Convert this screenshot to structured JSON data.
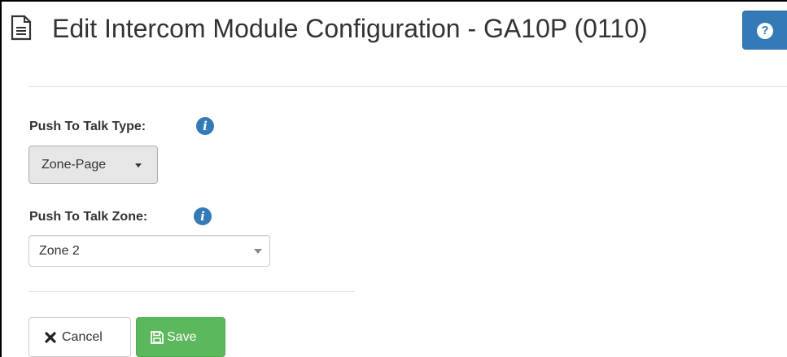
{
  "header": {
    "title": "Edit Intercom Module Configuration - GA10P (0110)",
    "doc_icon": "document-icon",
    "help_icon": "question-circle-icon",
    "help_icon_glyph": "?"
  },
  "form": {
    "push_to_talk_type": {
      "label": "Push To Talk Type:",
      "info_icon": "info-circle-icon",
      "info_glyph": "i",
      "selected": "Zone-Page"
    },
    "push_to_talk_zone": {
      "label": "Push To Talk Zone:",
      "info_icon": "info-circle-icon",
      "info_glyph": "i",
      "selected": "Zone 2"
    }
  },
  "actions": {
    "cancel_label": "Cancel",
    "cancel_icon": "close-icon",
    "save_label": "Save",
    "save_icon": "floppy-disk-icon"
  },
  "colors": {
    "primary": "#337ab7",
    "success": "#5cb85c",
    "text": "#333333",
    "dropdown_bg": "#e6e6e6"
  }
}
